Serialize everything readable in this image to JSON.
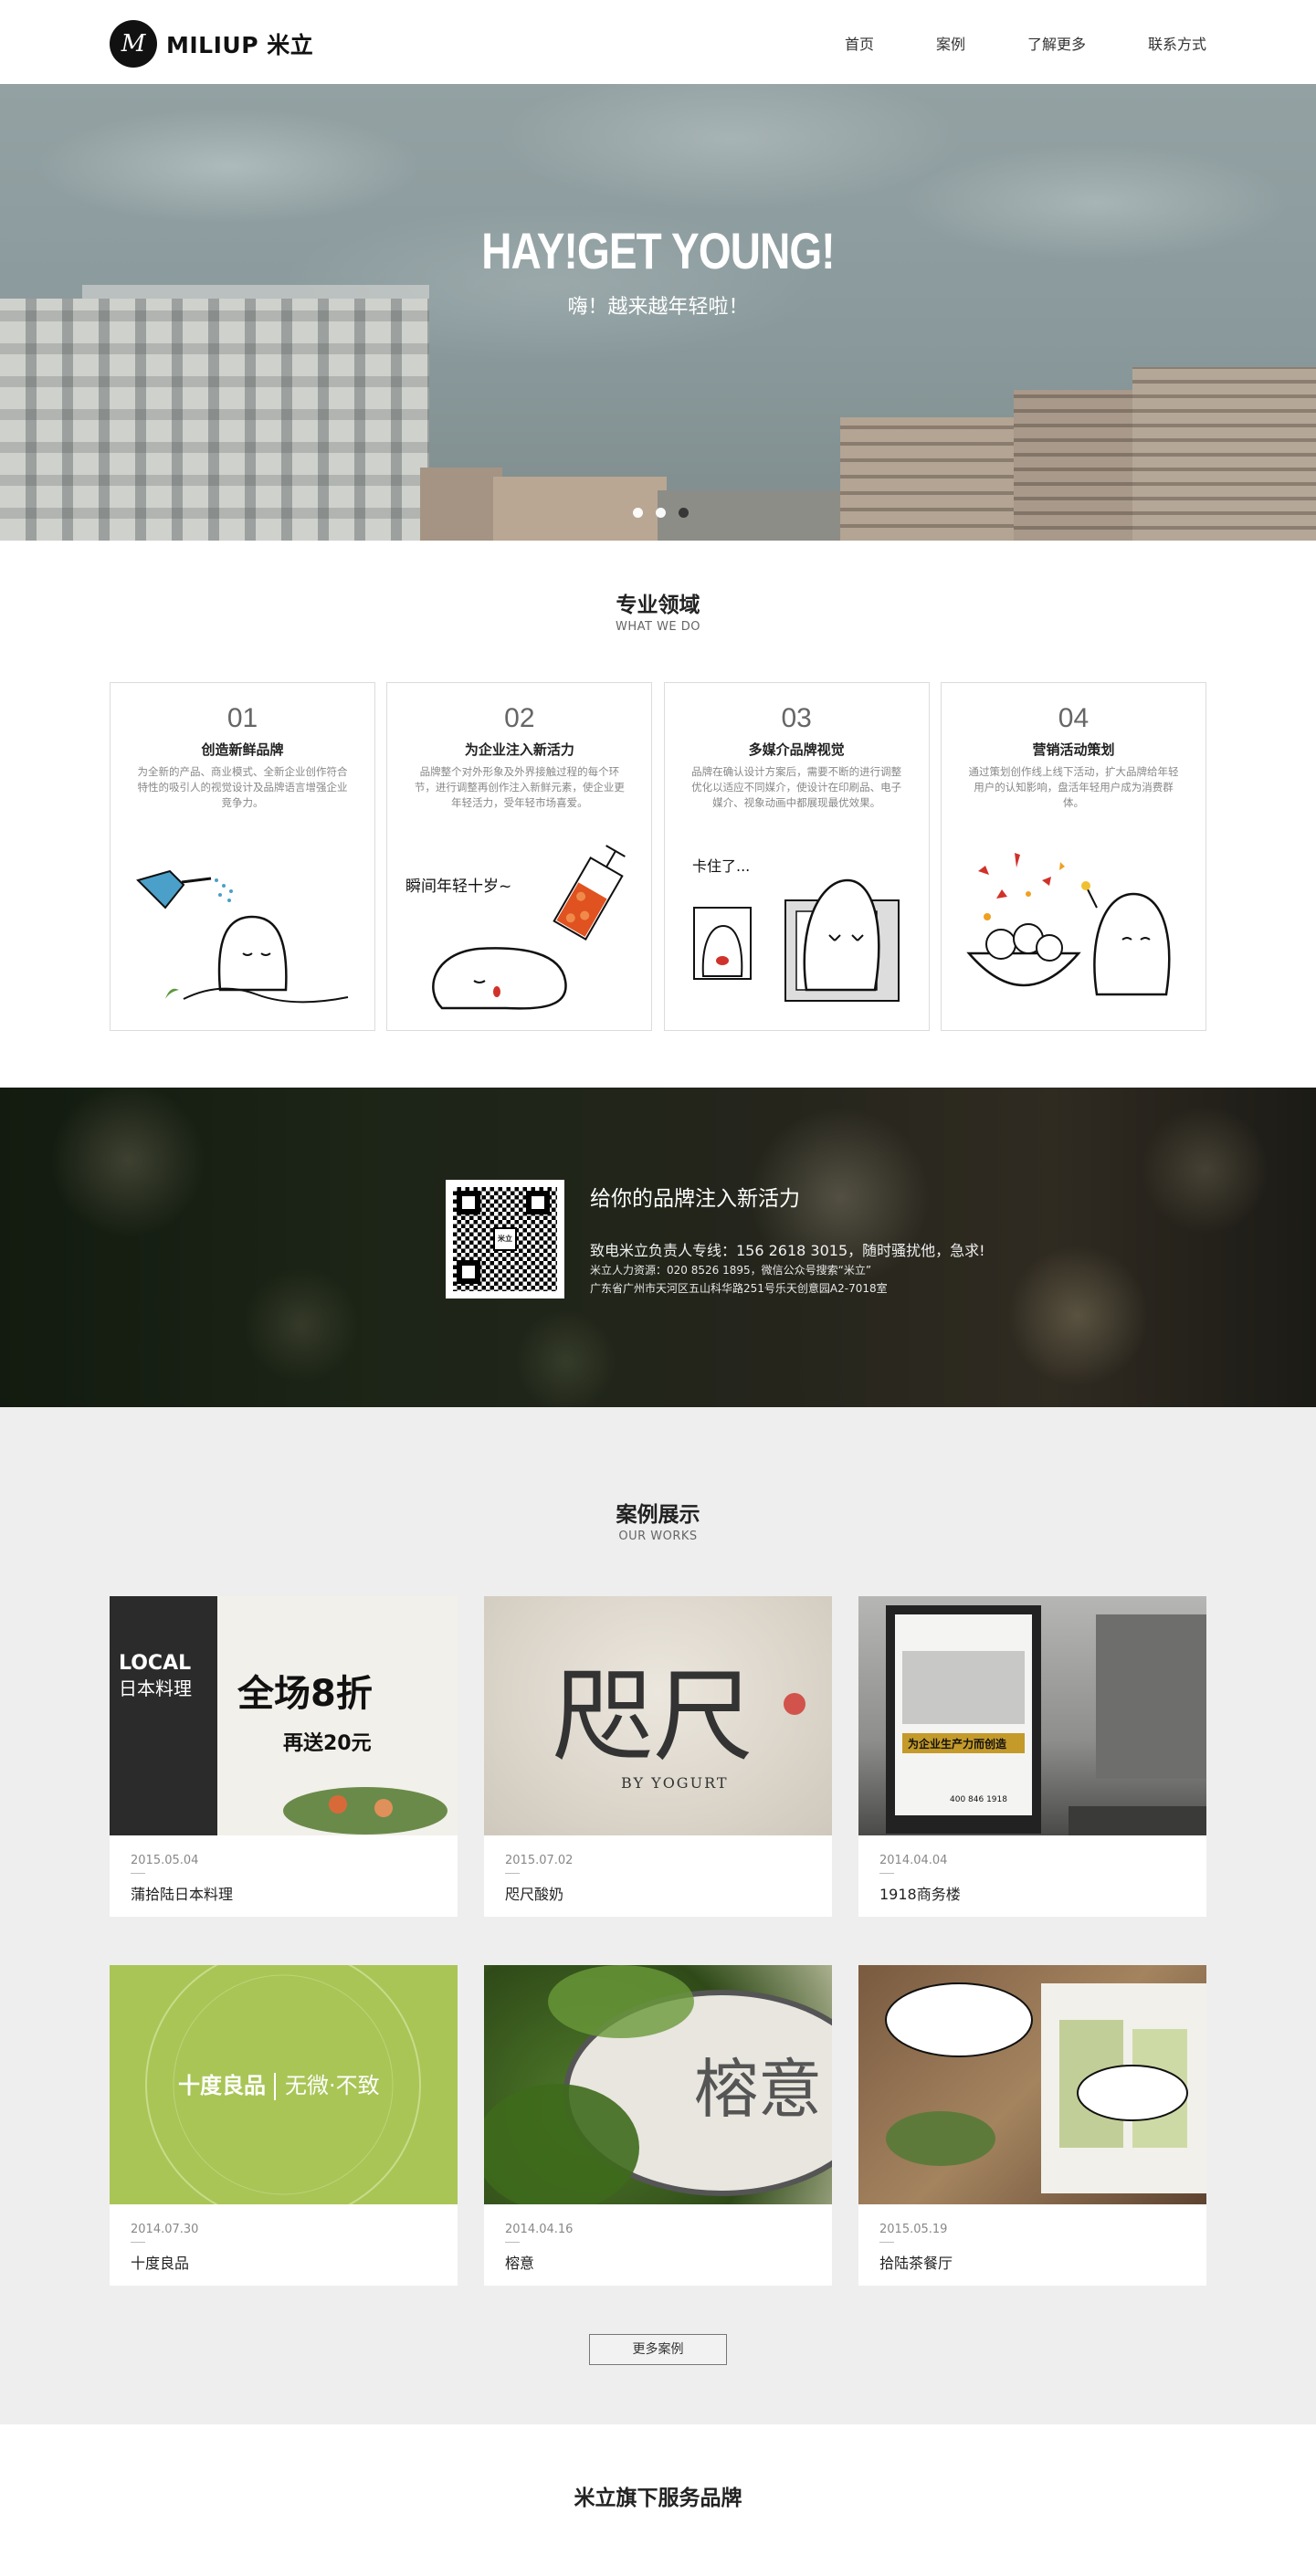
{
  "header": {
    "logo_mark": "M",
    "logo_text": "MILIUP 米立",
    "nav": [
      "首页",
      "案例",
      "了解更多",
      "联系方式"
    ]
  },
  "hero": {
    "title": "HAY!GET YOUNG!",
    "subtitle": "嗨！越来越年轻啦！",
    "slides": 3,
    "active_slide": 3
  },
  "services": {
    "title": "专业领域",
    "subtitle": "WHAT WE DO",
    "cards": [
      {
        "num": "01",
        "title": "创造新鲜品牌",
        "desc": "为全新的产品、商业模式、全新企业创作符合特性的吸引人的视觉设计及品牌语言增强企业竞争力。",
        "art_text": ""
      },
      {
        "num": "02",
        "title": "为企业注入新活力",
        "desc": "品牌整个对外形象及外界接触过程的每个环节，进行调整再创作注入新鲜元素，使企业更年轻活力，受年轻市场喜爱。",
        "art_text": "瞬间年轻十岁~"
      },
      {
        "num": "03",
        "title": "多媒介品牌视觉",
        "desc": "品牌在确认设计方案后，需要不断的进行调整优化以适应不同媒介，使设计在印刷品、电子媒介、视象动画中都展现最优效果。",
        "art_text": "卡住了..."
      },
      {
        "num": "04",
        "title": "营销活动策划",
        "desc": "通过策划创作线上线下活动，扩大品牌给年轻用户的认知影响，盘活年轻用户成为消费群体。",
        "art_text": ""
      }
    ]
  },
  "banner": {
    "title": "给你的品牌注入新活力",
    "line1": "致电米立负责人专线：156 2618 3015，随时骚扰他，急求!",
    "line2": "米立人力资源：020 8526 1895，微信公众号搜索“米立”",
    "line3": "广东省广州市天河区五山科华路251号乐天创意园A2-7018室",
    "qr_center": "米立"
  },
  "works": {
    "title": "案例展示",
    "subtitle": "OUR WORKS",
    "items": [
      {
        "date": "2015.05.04",
        "name": "蒲拾陆日本料理",
        "img_text_1": "LOCAL",
        "img_text_2": "日本料理",
        "img_text_3": "全场8折",
        "img_text_4": "再送20元"
      },
      {
        "date": "2015.07.02",
        "name": "咫尺酸奶",
        "img_text_1": "咫尺",
        "img_text_2": "BY YOGURT",
        "img_text_3": "",
        "img_text_4": ""
      },
      {
        "date": "2014.04.04",
        "name": "1918商务楼",
        "img_text_1": "为企业生产力而创造",
        "img_text_2": "400 846 1918",
        "img_text_3": "",
        "img_text_4": ""
      },
      {
        "date": "2014.07.30",
        "name": "十度良品",
        "img_text_1": "十度良品",
        "img_text_2": "无微·不致",
        "img_text_3": "",
        "img_text_4": ""
      },
      {
        "date": "2014.04.16",
        "name": "榕意",
        "img_text_1": "榕意",
        "img_text_2": "",
        "img_text_3": "",
        "img_text_4": ""
      },
      {
        "date": "2015.05.19",
        "name": "拾陆茶餐厅",
        "img_text_1": "",
        "img_text_2": "",
        "img_text_3": "",
        "img_text_4": ""
      }
    ],
    "more_button": "更多案例"
  },
  "footer": {
    "title": "米立旗下服务品牌"
  }
}
